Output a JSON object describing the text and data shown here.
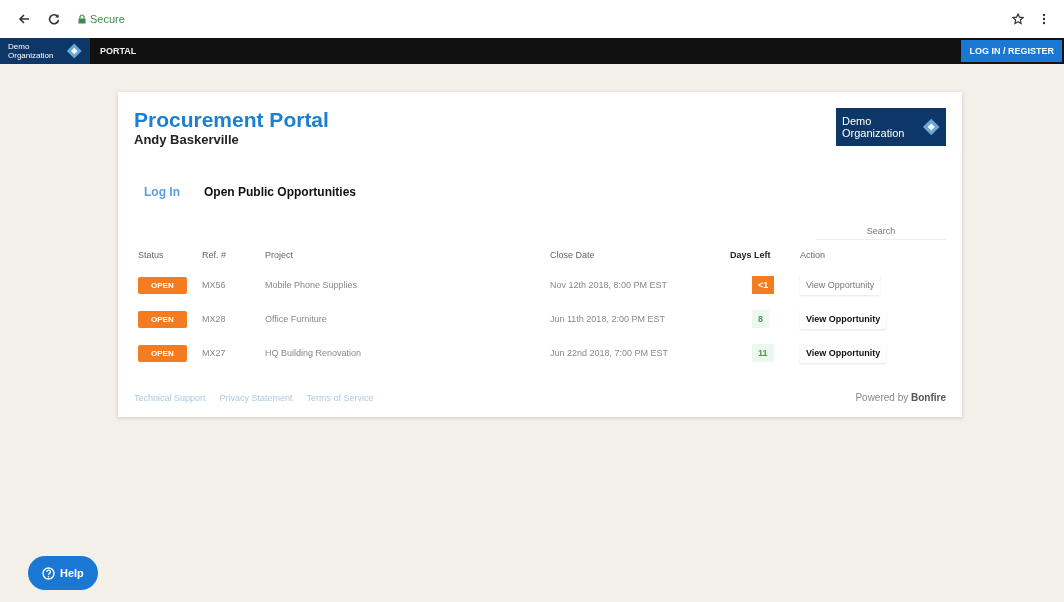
{
  "browser": {
    "security": "Secure"
  },
  "navbar": {
    "logo": "Demo Organization",
    "section": "PORTAL",
    "login_button": "LOG IN / REGISTER"
  },
  "card": {
    "title": "Procurement Portal",
    "subtitle": "Andy Baskerville",
    "logo": "Demo Organization",
    "tabs": [
      {
        "label": "Log In",
        "selected": false
      },
      {
        "label": "Open Public Opportunities",
        "selected": true
      }
    ],
    "search": {
      "placeholder": "Search"
    },
    "table": {
      "columns": [
        "Status",
        "Ref. #",
        "Project",
        "Close Date",
        "Days Left",
        "Action"
      ],
      "rows": [
        {
          "status": "OPEN",
          "ref": "MX56",
          "project": "Mobile Phone Supplies",
          "close_date": "Nov 12th 2018, 8:00 PM EST",
          "days_left": "<1",
          "kind": "urgent",
          "action": "View Opportunity",
          "highlighted": false
        },
        {
          "status": "OPEN",
          "ref": "MX28",
          "project": "Office Furniture",
          "close_date": "Jun 11th 2018, 2:00 PM EST",
          "days_left": "8",
          "kind": "normal",
          "action": "View Opportunity",
          "highlighted": true
        },
        {
          "status": "OPEN",
          "ref": "MX27",
          "project": "HQ Building Renovation",
          "close_date": "Jun 22nd 2018, 7:00 PM EST",
          "days_left": "11",
          "kind": "normal",
          "action": "View Opportunity",
          "highlighted": true
        }
      ]
    },
    "footer_links": [
      "Technical Support",
      "Privacy Statement",
      "Terms of Service"
    ],
    "powered_by": "Powered by",
    "brand": "Bonfire"
  },
  "help_button": "Help"
}
